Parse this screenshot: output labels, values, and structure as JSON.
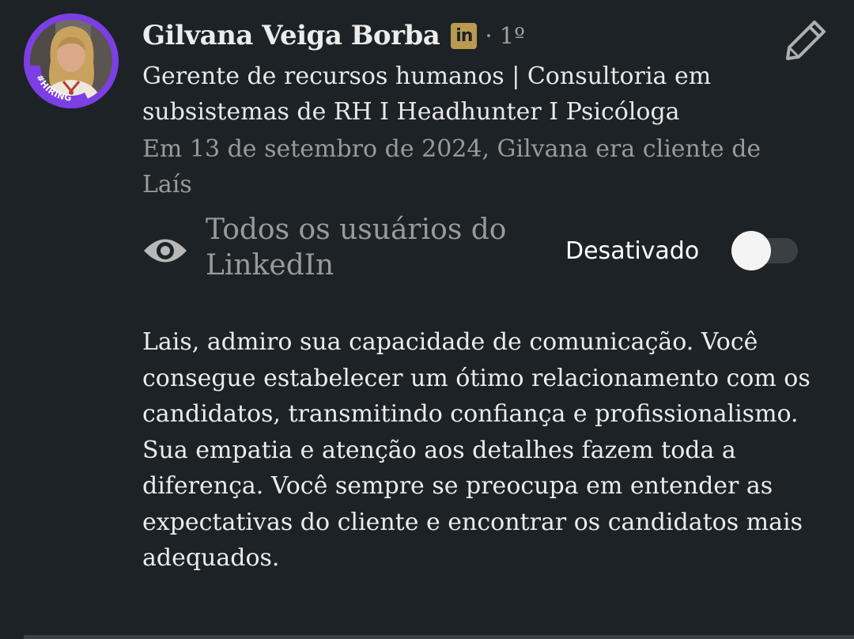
{
  "recommender": {
    "name": "Gilvana Veiga Borba",
    "badge_icon": "linkedin-premium-icon",
    "badge_text": "in",
    "degree": "· 1º",
    "avatar_tag": "#HIRING",
    "headline": "Gerente de recursos humanos | Consultoria em subsistemas de RH I Headhunter I Psicóloga",
    "relationship": "Em 13 de setembro de 2024, Gilvana era cliente de Laís"
  },
  "visibility": {
    "icon": "eye-icon",
    "label": "Todos os usuários do LinkedIn",
    "status": "Desativado",
    "enabled": false
  },
  "recommendation": {
    "paragraph_1": "Lais, admiro sua capacidade de comunicação. Você consegue estabelecer um ótimo relacionamento com os candidatos, transmitindo confiança e profissionalismo.",
    "paragraph_2": "Sua empatia e atenção aos detalhes fazem toda a diferença. Você sempre se preocupa em entender as expectativas do cliente e encontrar os candidatos mais adequados."
  },
  "actions": {
    "edit_icon": "pencil-icon"
  },
  "colors": {
    "background": "#1d2226",
    "premium_gold": "#b89a52",
    "hiring_purple": "#7b3fe4",
    "secondary_text": "#9a9a9a"
  }
}
